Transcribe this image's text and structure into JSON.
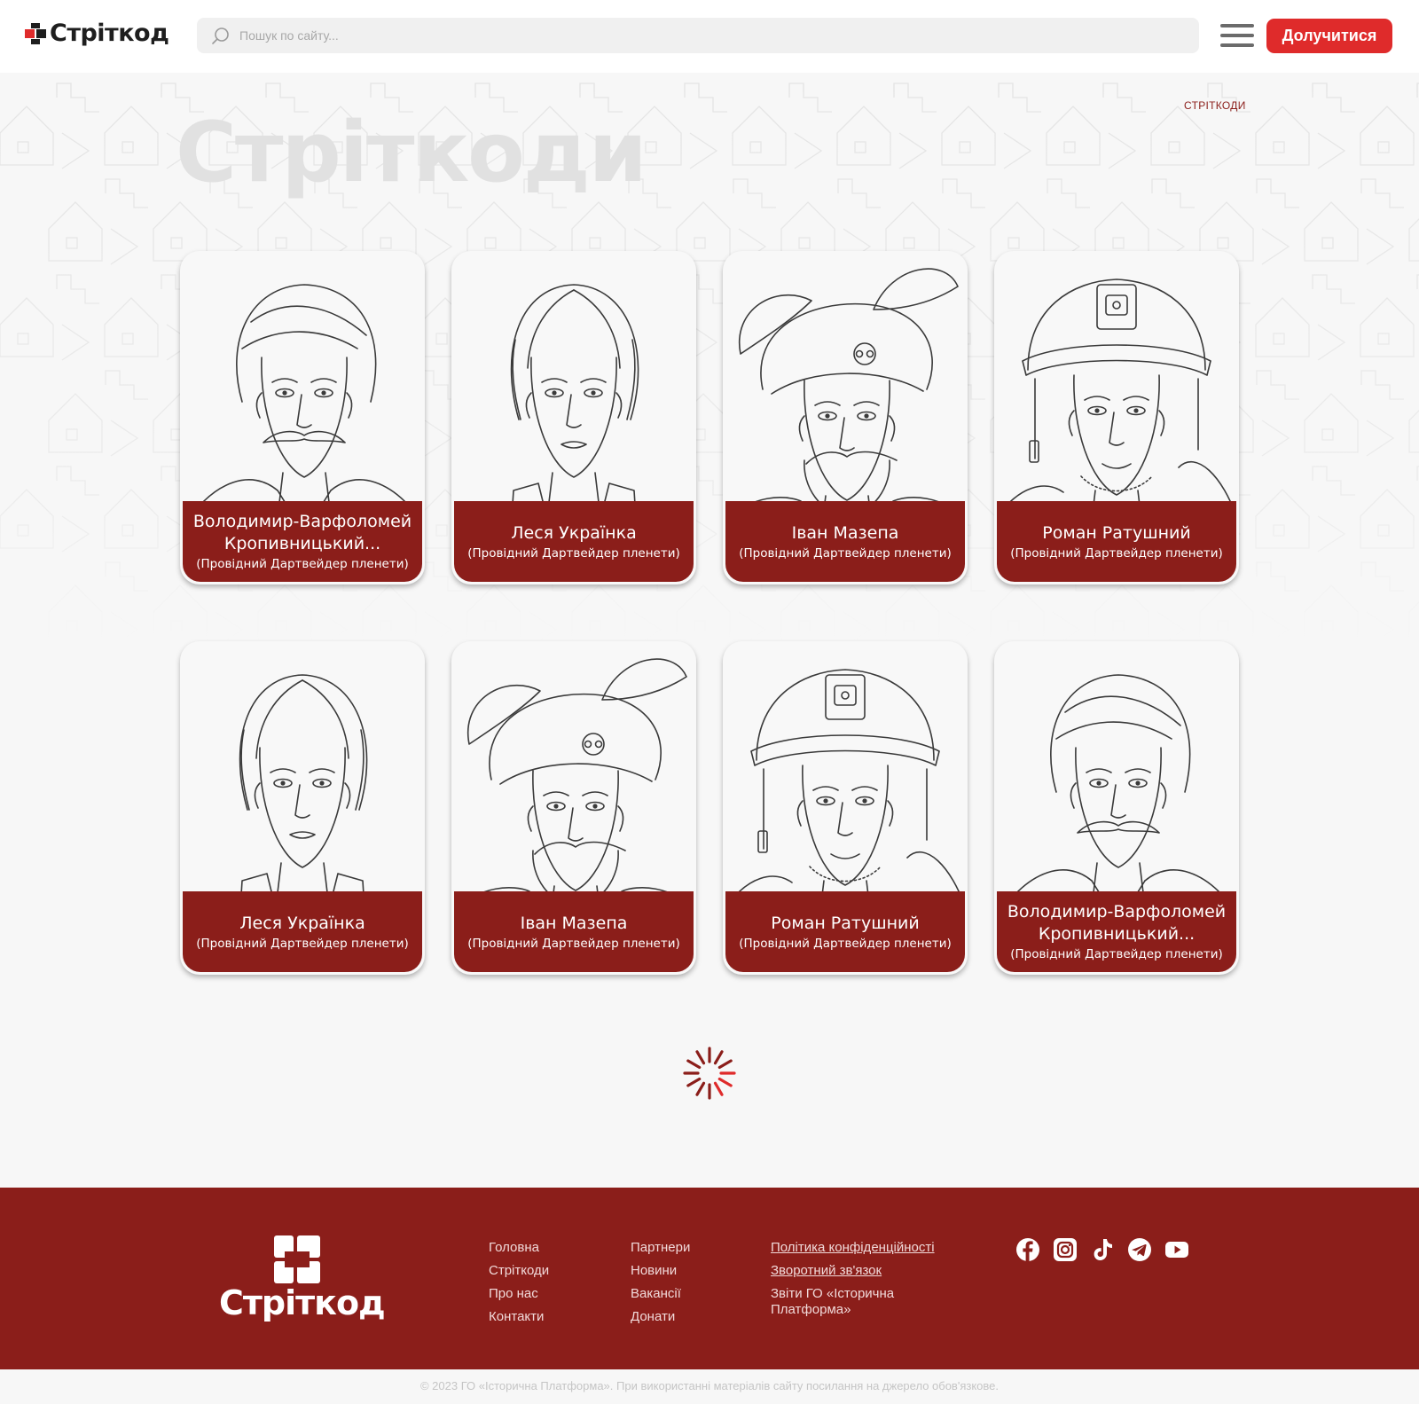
{
  "header": {
    "logo_text": "Стріткод",
    "search_placeholder": "Пошук по сайту...",
    "join_label": "Долучитися"
  },
  "hero": {
    "breadcrumb": "СТРІТКОДИ",
    "title": "Стріткоди"
  },
  "cards": [
    {
      "name": "Володимир-Варфоломей Кропивницький...",
      "role": "(Провідний Дартвейдер пленети)",
      "portrait": "man-mustache-portrait"
    },
    {
      "name": "Леся Українка",
      "role": "(Провідний Дартвейдер пленети)",
      "portrait": "woman-portrait"
    },
    {
      "name": "Іван Мазепа",
      "role": "(Провідний Дартвейдер пленети)",
      "portrait": "hetman-feathered-hat-portrait"
    },
    {
      "name": "Роман Ратушний",
      "role": "(Провідний Дартвейдер пленети)",
      "portrait": "soldier-helmet-portrait"
    },
    {
      "name": "Леся Українка",
      "role": "(Провідний Дартвейдер пленети)",
      "portrait": "woman-portrait"
    },
    {
      "name": "Іван Мазепа",
      "role": "(Провідний Дартвейдер пленети)",
      "portrait": "hetman-feathered-hat-portrait"
    },
    {
      "name": "Роман Ратушний",
      "role": "(Провідний Дартвейдер пленети)",
      "portrait": "soldier-helmet-portrait"
    },
    {
      "name": "Володимир-Варфоломей Кропивницький...",
      "role": "(Провідний Дартвейдер пленети)",
      "portrait": "man-mustache-portrait"
    }
  ],
  "footer": {
    "logo_text": "Стріткод",
    "col1": [
      "Головна",
      "Стріткоди",
      "Про нас",
      "Контакти"
    ],
    "col2": [
      "Партнери",
      "Новини",
      "Вакансії",
      "Донати"
    ],
    "col3": [
      "Політика конфіденційності",
      "Зворотний зв'язок",
      "Звіти ГО «Історична Платформа»"
    ],
    "socials": [
      "facebook-icon",
      "instagram-icon",
      "tiktok-icon",
      "telegram-icon",
      "youtube-icon"
    ],
    "copyright": "© 2023 ГО «Історична Платформа». При використанні матеріалів сайту посилання на джерело обов'язкове."
  },
  "colors": {
    "brand_red": "#8b1e1a",
    "accent_red": "#df2b2b",
    "logo_dark": "#1e1e1e"
  }
}
